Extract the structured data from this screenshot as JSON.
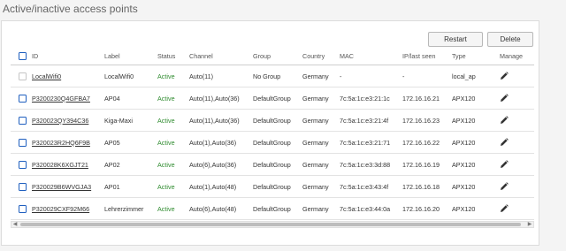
{
  "page": {
    "title": "Active/inactive access points"
  },
  "toolbar": {
    "restart_label": "Restart",
    "delete_label": "Delete"
  },
  "table": {
    "headers": {
      "id": "ID",
      "label": "Label",
      "status": "Status",
      "channel": "Channel",
      "group": "Group",
      "country": "Country",
      "mac": "MAC",
      "ip": "IP/last seen",
      "type": "Type",
      "manage": "Manage"
    },
    "rows": [
      {
        "id": "LocalWifi0",
        "label": "LocalWifi0",
        "status": "Active",
        "channel": "Auto(11)",
        "group": "No Group",
        "country": "Germany",
        "mac": "-",
        "ip": "-",
        "type": "local_ap",
        "checkbox_enabled": false
      },
      {
        "id": "P3200230Q4GFBA7",
        "label": "AP04",
        "status": "Active",
        "channel": "Auto(11),Auto(36)",
        "group": "DefaultGroup",
        "country": "Germany",
        "mac": "7c:5a:1c:e3:21:1c",
        "ip": "172.16.16.21",
        "type": "APX120",
        "checkbox_enabled": true
      },
      {
        "id": "P320023QY394C36",
        "label": "Kiga-Maxi",
        "status": "Active",
        "channel": "Auto(11),Auto(36)",
        "group": "DefaultGroup",
        "country": "Germany",
        "mac": "7c:5a:1c:e3:21:4f",
        "ip": "172.16.16.23",
        "type": "APX120",
        "checkbox_enabled": true
      },
      {
        "id": "P320023R2HQ6F9B",
        "label": "AP05",
        "status": "Active",
        "channel": "Auto(1),Auto(36)",
        "group": "DefaultGroup",
        "country": "Germany",
        "mac": "7c:5a:1c:e3:21:71",
        "ip": "172.16.16.22",
        "type": "APX120",
        "checkbox_enabled": true
      },
      {
        "id": "P320028K6XGJT21",
        "label": "AP02",
        "status": "Active",
        "channel": "Auto(6),Auto(36)",
        "group": "DefaultGroup",
        "country": "Germany",
        "mac": "7c:5a:1c:e3:3d:88",
        "ip": "172.16.16.19",
        "type": "APX120",
        "checkbox_enabled": true
      },
      {
        "id": "P320029B6WVGJA3",
        "label": "AP01",
        "status": "Active",
        "channel": "Auto(1),Auto(48)",
        "group": "DefaultGroup",
        "country": "Germany",
        "mac": "7c:5a:1c:e3:43:4f",
        "ip": "172.16.16.18",
        "type": "APX120",
        "checkbox_enabled": true
      },
      {
        "id": "P320029CXF92M66",
        "label": "Lehrerzimmer",
        "status": "Active",
        "channel": "Auto(6),Auto(48)",
        "group": "DefaultGroup",
        "country": "Germany",
        "mac": "7c:5a:1c:e3:44:0a",
        "ip": "172.16.16.20",
        "type": "APX120",
        "checkbox_enabled": true
      }
    ]
  },
  "icons": {
    "edit": "pencil-icon",
    "scroll_left": "arrow-left-icon",
    "scroll_right": "arrow-right-icon"
  },
  "colors": {
    "active_status": "#2e8b2e",
    "checkbox_border": "#1f5fbf"
  }
}
